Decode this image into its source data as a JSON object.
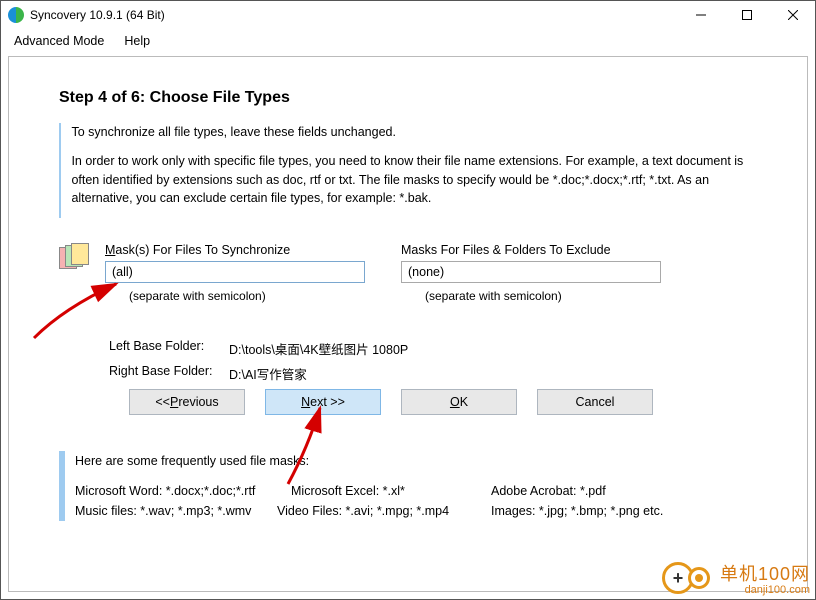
{
  "window": {
    "title": "Syncovery 10.9.1 (64 Bit)"
  },
  "menu": {
    "advanced": "Advanced Mode",
    "help": "Help"
  },
  "step": {
    "title": "Step 4 of 6: Choose File Types"
  },
  "info": {
    "p1": "To synchronize all file types, leave these fields unchanged.",
    "p2": "In order to work only with specific file types, you need to know their file name extensions. For example, a text document is often identified by extensions such as doc, rtf or txt. The file masks to specify would be *.doc;*.docx;*.rtf; *.txt. As an alternative, you can exclude certain file types, for example: *.bak."
  },
  "masks": {
    "sync_label_pre": "M",
    "sync_label_post": "ask(s) For Files To Synchronize",
    "sync_value": "(all)",
    "exclude_label": "Masks For Files & Folders To Exclude",
    "exclude_value": "(none)",
    "hint": "(separate with semicolon)"
  },
  "folders": {
    "left_label": "Left Base Folder:",
    "left_value": "D:\\tools\\桌面\\4K壁纸图片 1080P",
    "right_label": "Right Base Folder:",
    "right_value": "D:\\AI写作管家"
  },
  "buttons": {
    "prev_pre": "<< ",
    "prev_ul": "P",
    "prev_post": "revious",
    "next_ul": "N",
    "next_post": "ext >>",
    "ok_ul": "O",
    "ok_post": "K",
    "cancel": "Cancel"
  },
  "footer": {
    "intro": "Here are some frequently used file masks:",
    "line1a": "Microsoft Word: *.docx;*.doc;*.rtf",
    "line1b": "Microsoft Excel: *.xl*",
    "line1c": "Adobe Acrobat: *.pdf",
    "line2a": "Music files: *.wav; *.mp3; *.wmv",
    "line2b": "Video Files: *.avi; *.mpg; *.mp4",
    "line2c": "Images: *.jpg; *.bmp; *.png   etc."
  },
  "watermark": {
    "text": "单机100网",
    "sub": "danji100.com"
  }
}
